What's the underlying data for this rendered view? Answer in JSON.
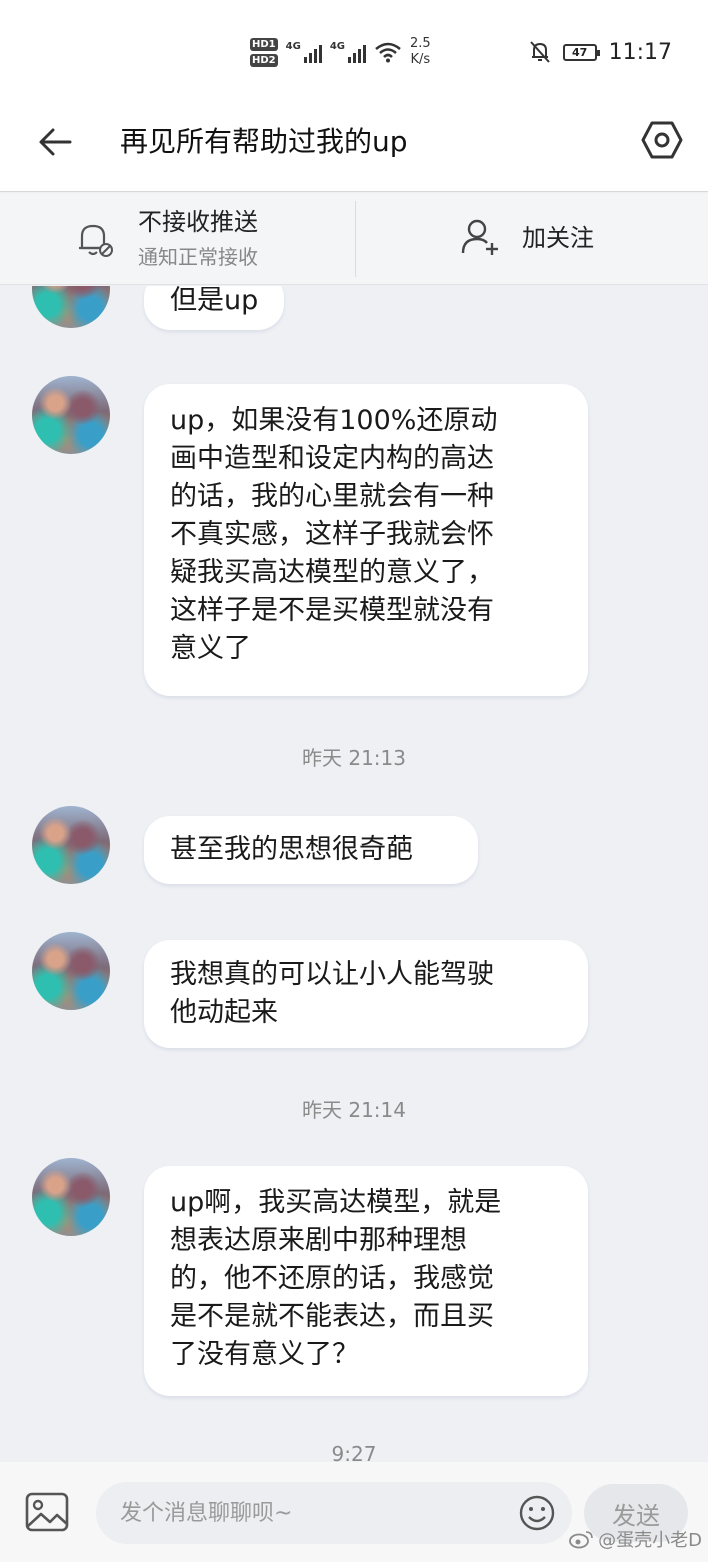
{
  "status_bar": {
    "hd_tags": [
      "HD1",
      "HD2"
    ],
    "network_labels": [
      "4G",
      "4G"
    ],
    "speed_value": "2.5",
    "speed_unit": "K/s",
    "battery": "47",
    "time": "11:17"
  },
  "header": {
    "title": "再见所有帮助过我的up"
  },
  "subscription": {
    "push_label": "不接收推送",
    "push_sublabel": "通知正常接收",
    "follow_label": "加关注"
  },
  "messages": [
    {
      "text": "但是up"
    },
    {
      "text": "up，如果没有100%还原动\n画中造型和设定内构的高达\n的话，我的心里就会有一种\n不真实感，这样子我就会怀\n疑我买高达模型的意义了，\n这样子是不是买模型就没有\n意义了"
    },
    {
      "text": "甚至我的思想很奇葩"
    },
    {
      "text": "我想真的可以让小人能驾驶\n他动起来"
    },
    {
      "text": "up啊，我买高达模型，就是\n想表达原来剧中那种理想\n的，他不还原的话，我感觉\n是不是就不能表达，而且买\n了没有意义了？"
    }
  ],
  "timestamps": [
    "昨天 21:13",
    "昨天 21:14",
    "9:27"
  ],
  "input": {
    "placeholder": "发个消息聊聊呗~",
    "send_label": "发送"
  },
  "watermark": "@蛋壳小老D",
  "colors": {
    "background": "#eef0f4",
    "bubble": "#ffffff",
    "muted_text": "#8a8a8a"
  }
}
